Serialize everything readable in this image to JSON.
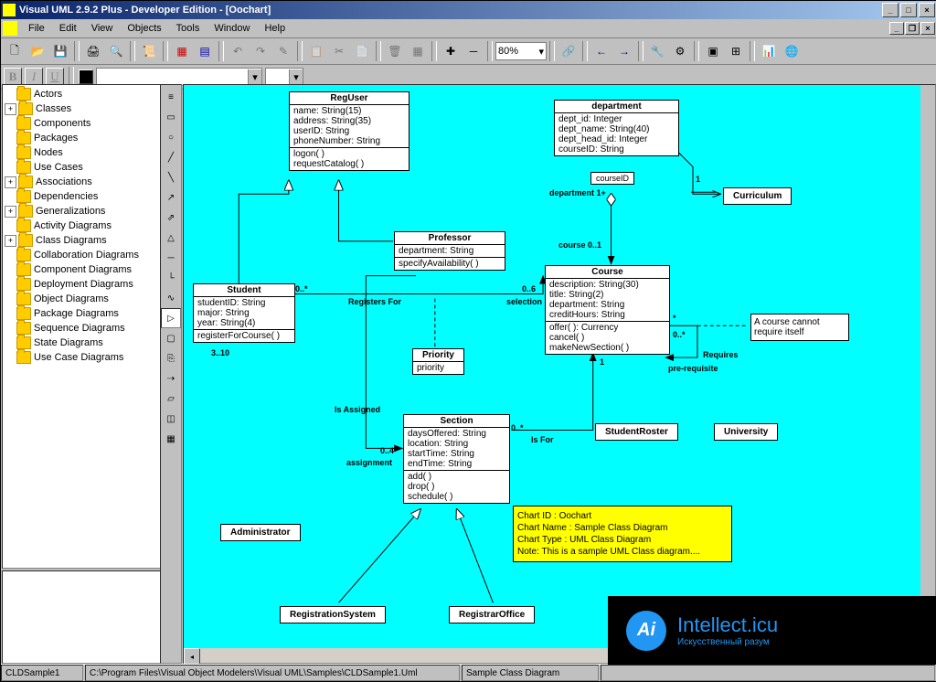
{
  "title": "Visual UML 2.9.2 Plus - Developer Edition - [Oochart]",
  "menu": {
    "file": "File",
    "edit": "Edit",
    "view": "View",
    "objects": "Objects",
    "tools": "Tools",
    "window": "Window",
    "help": "Help"
  },
  "zoom": "80%",
  "format": {
    "b": "B",
    "i": "I",
    "u": "U"
  },
  "tree": [
    {
      "label": "Actors",
      "exp": ""
    },
    {
      "label": "Classes",
      "exp": "+"
    },
    {
      "label": "Components",
      "exp": ""
    },
    {
      "label": "Packages",
      "exp": ""
    },
    {
      "label": "Nodes",
      "exp": ""
    },
    {
      "label": "Use Cases",
      "exp": ""
    },
    {
      "label": "Associations",
      "exp": "+"
    },
    {
      "label": "Dependencies",
      "exp": ""
    },
    {
      "label": "Generalizations",
      "exp": "+"
    },
    {
      "label": "Activity Diagrams",
      "exp": ""
    },
    {
      "label": "Class Diagrams",
      "exp": "+"
    },
    {
      "label": "Collaboration Diagrams",
      "exp": ""
    },
    {
      "label": "Component Diagrams",
      "exp": ""
    },
    {
      "label": "Deployment Diagrams",
      "exp": ""
    },
    {
      "label": "Object Diagrams",
      "exp": ""
    },
    {
      "label": "Package Diagrams",
      "exp": ""
    },
    {
      "label": "Sequence Diagrams",
      "exp": ""
    },
    {
      "label": "State Diagrams",
      "exp": ""
    },
    {
      "label": "Use Case Diagrams",
      "exp": ""
    }
  ],
  "classes": {
    "reguser": {
      "name": "RegUser",
      "attrs": [
        "name: String(15)",
        "address: String(35)",
        "userID: String",
        "phoneNumber: String"
      ],
      "ops": [
        "logon( )",
        "requestCatalog( )"
      ]
    },
    "department": {
      "name": "department",
      "attrs": [
        "dept_id: Integer",
        "dept_name: String(40)",
        "dept_head_id: Integer",
        "courseID: String"
      ]
    },
    "professor": {
      "name": "Professor",
      "attrs": [
        "department: String"
      ],
      "ops": [
        "specifyAvailability( )"
      ]
    },
    "student": {
      "name": "Student",
      "attrs": [
        "studentID: String",
        "major: String",
        "year: String(4)"
      ],
      "ops": [
        "registerForCourse( )"
      ]
    },
    "course": {
      "name": "Course",
      "attrs": [
        "description: String(30)",
        "title: String(2)",
        "department: String",
        "creditHours: String"
      ],
      "ops": [
        "offer( ): Currency",
        "cancel( )",
        "makeNewSection( )"
      ]
    },
    "section": {
      "name": "Section",
      "attrs": [
        "daysOffered: String",
        "location: String",
        "startTime: String",
        "endTime: String"
      ],
      "ops": [
        "add( )",
        "drop( )",
        "schedule( )"
      ]
    },
    "priority": {
      "name": "Priority",
      "attrs": [
        "priority"
      ]
    },
    "curriculum": "Curriculum",
    "studentroster": "StudentRoster",
    "university": "University",
    "administrator": "Administrator",
    "registrationsystem": "RegistrationSystem",
    "registraroffice": "RegistrarOffice"
  },
  "labels": {
    "courseid": "courseID",
    "department1": "department 1+",
    "course_mult": "course   0..1",
    "zero_six": "0..6",
    "selection": "selection",
    "registers": "Registers For",
    "zero_star": "0..*",
    "three_ten": "3..10",
    "isassigned": "Is Assigned",
    "zero_four": "0..4",
    "assignment": "assignment",
    "zero_star2": "0..*",
    "isfor": "Is For",
    "one": "1",
    "one2": "1",
    "star": "*",
    "zero_star3": "0..*",
    "requires": "Requires",
    "prereq": "pre-requisite"
  },
  "note": {
    "l1": "Chart ID : Oochart",
    "l2": "Chart Name : Sample Class Diagram",
    "l3": "Chart Type : UML Class Diagram",
    "l4": "Note: This is a sample UML Class diagram...."
  },
  "note2": "A course cannot require itself",
  "status": {
    "s1": "CLDSample1",
    "s2": "C:\\Program Files\\Visual Object Modelers\\Visual UML\\Samples\\CLDSample1.Uml",
    "s3": "Sample Class Diagram"
  },
  "watermark": {
    "brand": "Intellect.icu",
    "tag": "Искусственный разум",
    "logo": "Ai"
  }
}
